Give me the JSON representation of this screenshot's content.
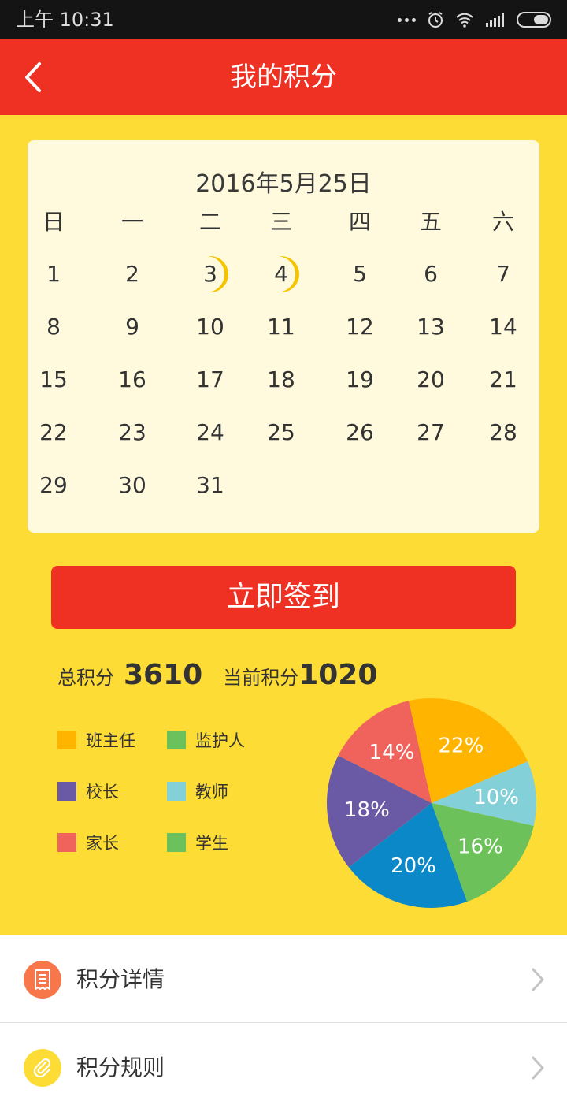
{
  "status_bar": {
    "time": "上午 10:31"
  },
  "header": {
    "title": "我的积分",
    "back_icon": "chevron-left-icon"
  },
  "calendar": {
    "title": "2016年5月25日",
    "weekdays": [
      "日",
      "一",
      "二",
      "三",
      "四",
      "五",
      "六"
    ],
    "days": [
      "1",
      "2",
      "3",
      "4",
      "5",
      "6",
      "7",
      "8",
      "9",
      "10",
      "11",
      "12",
      "13",
      "14",
      "15",
      "16",
      "17",
      "18",
      "19",
      "20",
      "21",
      "22",
      "23",
      "24",
      "25",
      "26",
      "27",
      "28",
      "29",
      "30",
      "31"
    ],
    "checked_in_days": [
      "3",
      "4"
    ],
    "marker_color": "#f5c400"
  },
  "signin_button": {
    "label": "立即签到"
  },
  "points": {
    "total_label": "总积分",
    "total_value": "3610",
    "current_label": "当前积分",
    "current_value": "1020"
  },
  "legend": [
    {
      "label": "班主任",
      "color": "#ffb500"
    },
    {
      "label": "监护人",
      "color": "#6cc15a"
    },
    {
      "label": "校长",
      "color": "#6a5aa6"
    },
    {
      "label": "教师",
      "color": "#84d0d8"
    },
    {
      "label": "家长",
      "color": "#f0635c"
    },
    {
      "label": "学生",
      "color": "#6cc15a"
    }
  ],
  "chart_data": {
    "type": "pie",
    "slices": [
      {
        "label": "22%",
        "value": 22,
        "color": "#ffb500"
      },
      {
        "label": "10%",
        "value": 10,
        "color": "#84d0d8"
      },
      {
        "label": "16%",
        "value": 16,
        "color": "#6cc15a"
      },
      {
        "label": "20%",
        "value": 20,
        "color": "#0a88c8"
      },
      {
        "label": "18%",
        "value": 18,
        "color": "#6a5aa6"
      },
      {
        "label": "14%",
        "value": 14,
        "color": "#f0635c"
      }
    ]
  },
  "menu": [
    {
      "label": "积分详情",
      "icon": "receipt-icon",
      "icon_color": "#f7774a"
    },
    {
      "label": "积分规则",
      "icon": "paperclip-icon",
      "icon_color": "#fedc36"
    }
  ],
  "colors": {
    "header": "#ef3124",
    "background": "#fedc36",
    "card": "#fffade"
  }
}
